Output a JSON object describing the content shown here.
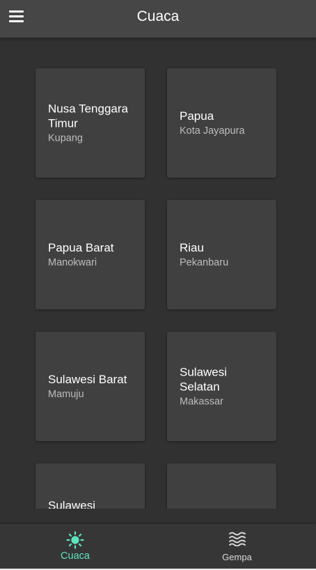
{
  "appbar": {
    "title": "Cuaca",
    "menu_icon": "hamburger-menu-icon"
  },
  "cards": [
    {
      "province": "Nusa Tenggara Timur",
      "city": "Kupang"
    },
    {
      "province": "Papua",
      "city": "Kota Jayapura"
    },
    {
      "province": "Papua Barat",
      "city": "Manokwari"
    },
    {
      "province": "Riau",
      "city": "Pekanbaru"
    },
    {
      "province": "Sulawesi Barat",
      "city": "Mamuju"
    },
    {
      "province": "Sulawesi Selatan",
      "city": "Makassar"
    },
    {
      "province": "Sulawesi",
      "city": ""
    },
    {
      "province": "",
      "city": ""
    }
  ],
  "bottom_nav": {
    "items": [
      {
        "label": "Cuaca",
        "icon": "sun-icon",
        "active": true
      },
      {
        "label": "Gempa",
        "icon": "waves-icon",
        "active": false
      }
    ]
  },
  "colors": {
    "background": "#313131",
    "appbar": "#464646",
    "card": "#404040",
    "accent": "#5de3c0",
    "nav_inactive": "#d9d9d9"
  }
}
